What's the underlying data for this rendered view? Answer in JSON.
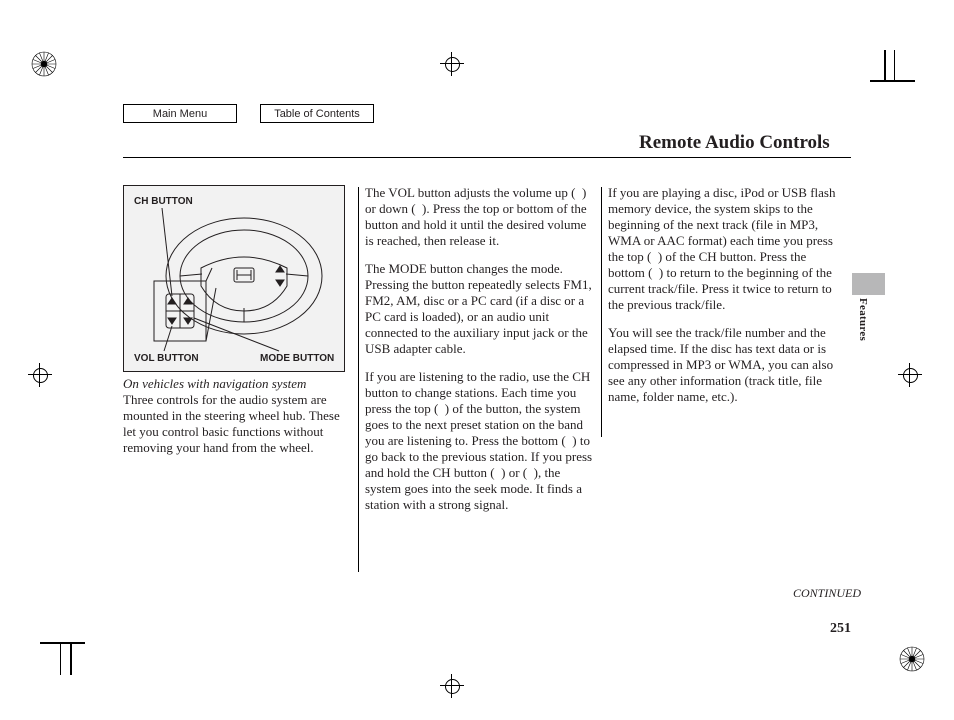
{
  "nav": {
    "main_menu": "Main Menu",
    "toc": "Table of Contents"
  },
  "title": "Remote Audio Controls",
  "side_tab": "Features",
  "continued": "CONTINUED",
  "page_number": "251",
  "diagram": {
    "ch_button": "CH BUTTON",
    "vol_button": "VOL BUTTON",
    "mode_button": "MODE BUTTON"
  },
  "col1": {
    "nav_note": "On vehicles with navigation system",
    "p1": "Three controls for the audio system are mounted in the steering wheel hub. These let you control basic functions without removing your hand from the wheel."
  },
  "col2": {
    "p1": "The VOL button adjusts the volume up (  ) or down (  ). Press the top or bottom of the button and hold it until the desired volume is reached, then release it.",
    "p2": "The MODE button changes the mode. Pressing the button repeatedly selects FM1, FM2, AM, disc or a PC card (if a disc or a PC card is loaded), or an audio unit connected to the auxiliary input jack or the USB adapter cable.",
    "p3": "If you are listening to the radio, use the CH button to change stations. Each time you press the top (  ) of the button, the system goes to the next preset station on the band you are listening to. Press the bottom (  ) to go back to the previous station. If you press and hold the CH button (  ) or (  ), the system goes into the seek mode. It finds a station with a strong signal."
  },
  "col3": {
    "p1": "If you are playing a disc, iPod or USB flash memory device, the system skips to the beginning of the next track (file in MP3, WMA or AAC format) each time you press the top (  ) of the CH button. Press the bottom (  ) to return to the beginning of the current track/file. Press it twice to return to the previous track/file.",
    "p2": "You will see the track/file number and the elapsed time. If the disc has text data or is compressed in MP3 or WMA, you can also see any other information (track title, file name, folder name, etc.)."
  }
}
